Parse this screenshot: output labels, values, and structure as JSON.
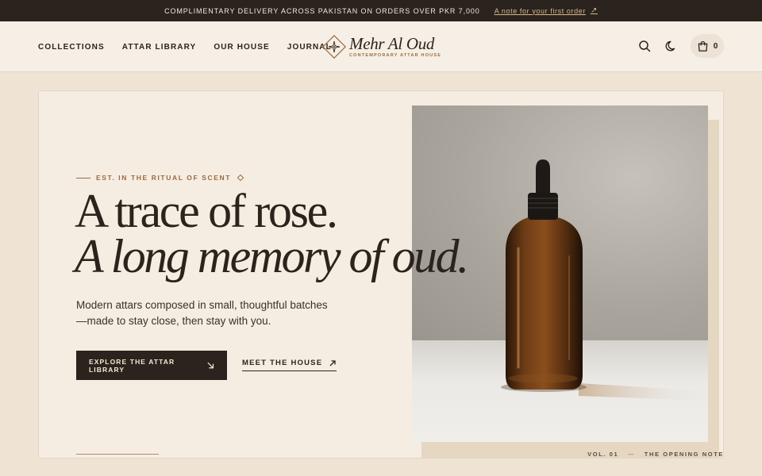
{
  "announcement": {
    "text": "COMPLIMENTARY DELIVERY ACROSS PAKISTAN ON ORDERS OVER PKR 7,000",
    "link_label": "A note for your first order"
  },
  "nav": {
    "items": [
      {
        "label": "COLLECTIONS"
      },
      {
        "label": "ATTAR LIBRARY"
      },
      {
        "label": "OUR HOUSE"
      },
      {
        "label": "JOURNAL"
      }
    ]
  },
  "brand": {
    "name": "Mehr Al Oud",
    "tagline": "CONTEMPORARY ATTAR HOUSE"
  },
  "cart": {
    "count": "0"
  },
  "hero": {
    "eyebrow": "EST. IN THE RITUAL OF SCENT",
    "headline_line1": "A trace of rose.",
    "headline_line2": "A long memory of oud.",
    "description": "Modern attars composed in small, thoughtful batches—made to stay close, then stay with you.",
    "primary_cta": "EXPLORE THE ATTAR LIBRARY",
    "secondary_cta": "MEET THE HOUSE",
    "volume": "VOL. 01",
    "volume_separator": "—",
    "volume_title": "THE OPENING NOTE"
  },
  "colors": {
    "announcement_bg": "#2a231e",
    "accent": "#9a6a3f",
    "page_bg": "#efe3d3"
  },
  "icons": [
    "arrow-up-right-icon",
    "search-icon",
    "moon-icon",
    "shopping-bag-icon",
    "arrow-down-right-icon",
    "diamond-icon"
  ]
}
